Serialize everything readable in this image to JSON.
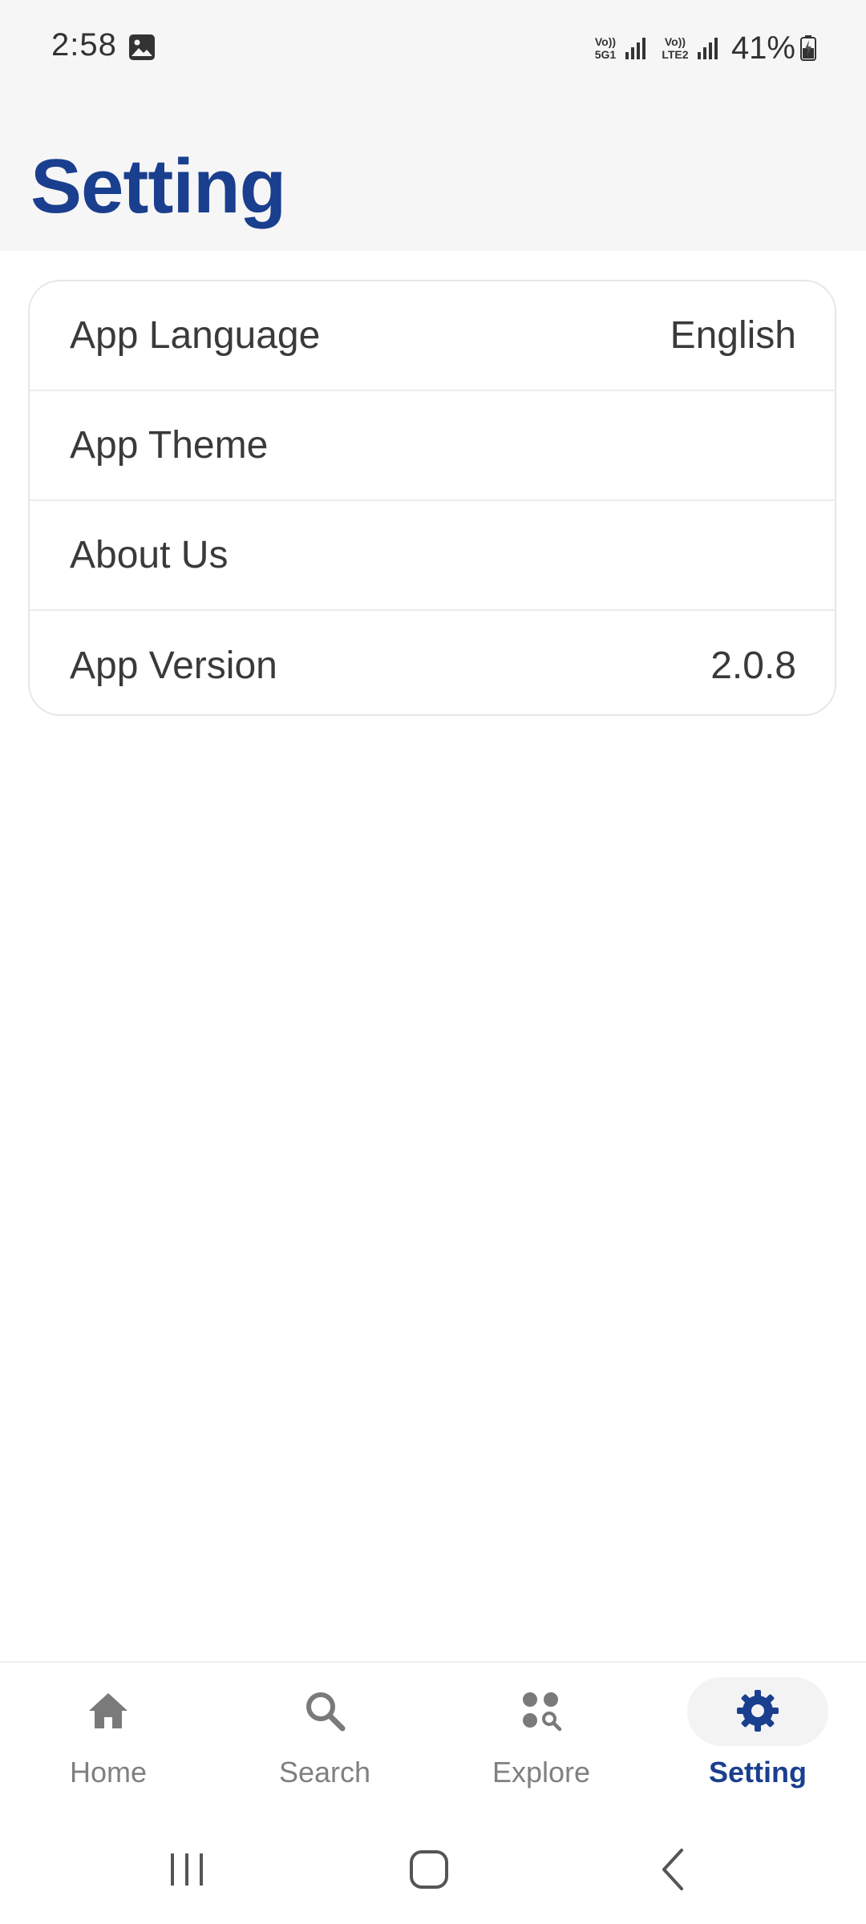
{
  "status_bar": {
    "time": "2:58",
    "net1": "Vo)) 5G1",
    "net2": "Vo)) LTE2",
    "battery": "41%"
  },
  "header": {
    "title": "Setting"
  },
  "settings": {
    "items": [
      {
        "label": "App Language",
        "value": "English"
      },
      {
        "label": "App Theme",
        "value": ""
      },
      {
        "label": "About Us",
        "value": ""
      },
      {
        "label": "App Version",
        "value": "2.0.8"
      }
    ]
  },
  "bottom_nav": {
    "items": [
      {
        "label": "Home",
        "icon": "home-icon"
      },
      {
        "label": "Search",
        "icon": "search-icon"
      },
      {
        "label": "Explore",
        "icon": "explore-icon"
      },
      {
        "label": "Setting",
        "icon": "gear-icon"
      }
    ],
    "active": "Setting"
  },
  "colors": {
    "accent": "#1a3f8e",
    "header_bg": "#f6f6f7",
    "inactive": "#808080",
    "text": "#3a3a3a"
  }
}
